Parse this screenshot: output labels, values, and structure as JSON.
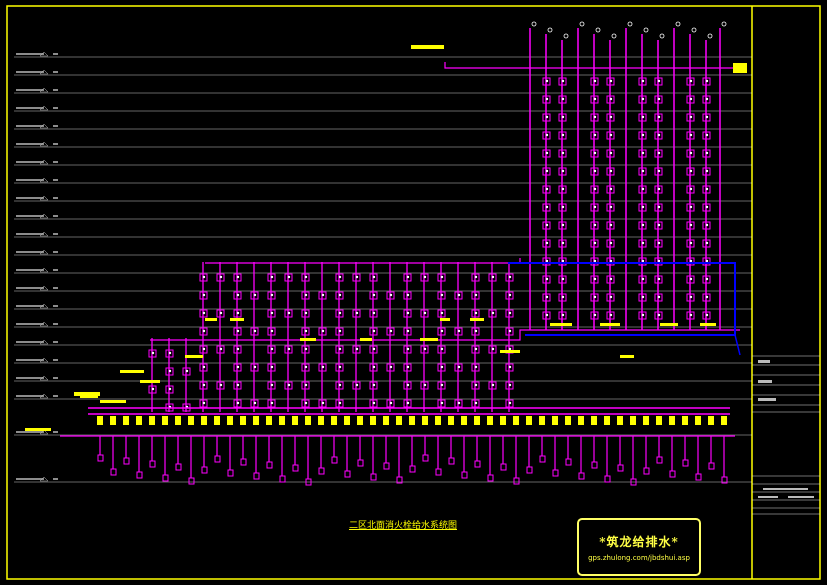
{
  "drawing": {
    "title": "二区北面消火栓给水系统图",
    "colors": {
      "background": "#000000",
      "frame": "#ffff00",
      "floor_lines": "#ffffff",
      "fire_pipe": "#ff00ff",
      "main_pipe": "#0000ff",
      "tag": "#ffff00",
      "riser_cap": "#ffffff"
    }
  },
  "watermark": {
    "name": "*筑龙给排水*",
    "url": "gps.zhulong.com/jbdshui.asp"
  }
}
